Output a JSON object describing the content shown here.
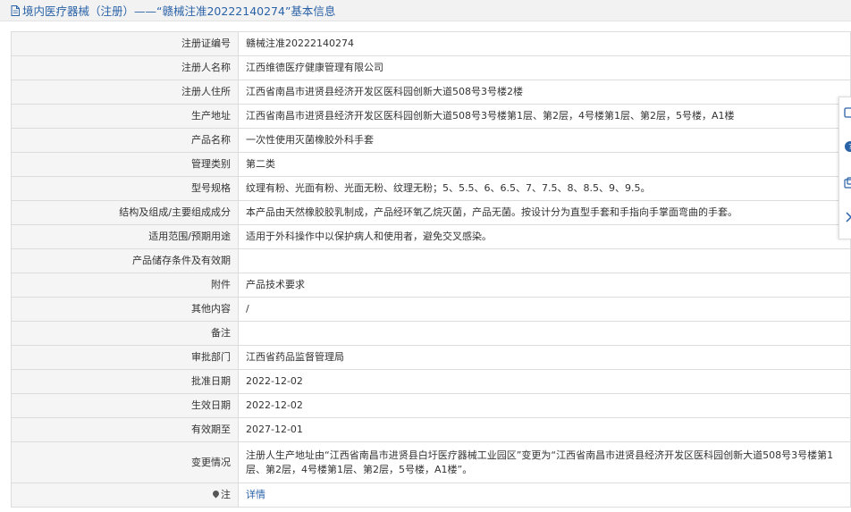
{
  "header": {
    "title": "境内医疗器械（注册）——“赣械注准20222140274”基本信息"
  },
  "rows": [
    {
      "label": "注册证编号",
      "value": "赣械注准20222140274"
    },
    {
      "label": "注册人名称",
      "value": "江西维德医疗健康管理有限公司"
    },
    {
      "label": "注册人住所",
      "value": "江西省南昌市进贤县经济开发区医科园创新大道508号3号楼2楼"
    },
    {
      "label": "生产地址",
      "value": "江西省南昌市进贤县经济开发区医科园创新大道508号3号楼第1层、第2层，4号楼第1层、第2层，5号楼，A1楼"
    },
    {
      "label": "产品名称",
      "value": "一次性使用灭菌橡胶外科手套"
    },
    {
      "label": "管理类别",
      "value": "第二类"
    },
    {
      "label": "型号规格",
      "value": "纹理有粉、光面有粉、光面无粉、纹理无粉；5、5.5、6、6.5、7、7.5、8、8.5、9、9.5。"
    },
    {
      "label": "结构及组成/主要组成成分",
      "value": "本产品由天然橡胶胶乳制成，产品经环氧乙烷灭菌，产品无菌。按设计分为直型手套和手指向手掌面弯曲的手套。"
    },
    {
      "label": "适用范围/预期用途",
      "value": "适用于外科操作中以保护病人和使用者，避免交叉感染。"
    },
    {
      "label": "产品储存条件及有效期",
      "value": ""
    },
    {
      "label": "附件",
      "value": "产品技术要求"
    },
    {
      "label": "其他内容",
      "value": "/"
    },
    {
      "label": "备注",
      "value": ""
    },
    {
      "label": "审批部门",
      "value": "江西省药品监督管理局"
    },
    {
      "label": "批准日期",
      "value": "2022-12-02"
    },
    {
      "label": "生效日期",
      "value": "2022-12-02"
    },
    {
      "label": "有效期至",
      "value": "2027-12-01"
    },
    {
      "label": "变更情况",
      "value": "注册人生产地址由“江西省南昌市进贤县白圩医疗器械工业园区”变更为“江西省南昌市进贤县经济开发区医科园创新大道508号3号楼第1层、第2层，4号楼第1层、第2层，5号楼，A1楼”。"
    }
  ],
  "note": {
    "label": "注",
    "link": "详情"
  },
  "colors": {
    "link": "#2a62a8",
    "label_bg": "#f5f5f5",
    "border": "#dcdcdc",
    "titlebar_bg": "#f2f2f2"
  },
  "icons": {
    "title": "document-icon",
    "note": "location-pin-icon",
    "side": [
      "share-icon",
      "help-icon",
      "copy-icon",
      "chevron-right-icon"
    ]
  }
}
